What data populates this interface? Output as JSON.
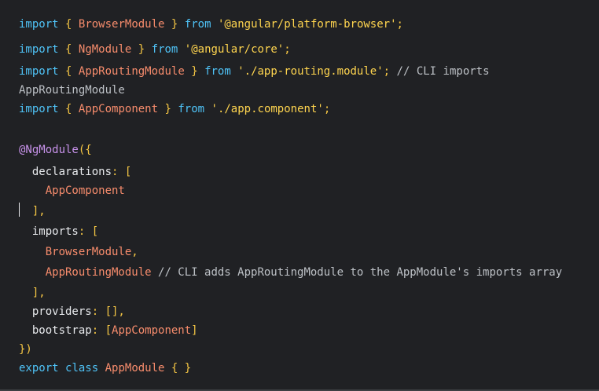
{
  "code": {
    "line1": {
      "k1": "import",
      "b1": "{",
      "c1": "BrowserModule",
      "b2": "}",
      "k2": "from",
      "s1": "'@angular/platform-browser'",
      "p1": ";"
    },
    "line2": {
      "k1": "import",
      "b1": "{",
      "c1": "NgModule",
      "b2": "}",
      "k2": "from",
      "s1": "'@angular/core'",
      "p1": ";"
    },
    "line3": {
      "k1": "import",
      "b1": "{",
      "c1": "AppRoutingModule",
      "b2": "}",
      "k2": "from",
      "s1": "'./app-routing.module'",
      "p1": ";",
      "cm": "// CLI imports"
    },
    "line3b": {
      "t": "AppRoutingModule"
    },
    "line4": {
      "k1": "import",
      "b1": "{",
      "c1": "AppComponent",
      "b2": "}",
      "k2": "from",
      "s1": "'./app.component'",
      "p1": ";"
    },
    "line6": {
      "d": "@NgModule",
      "p": "({"
    },
    "line7": {
      "prop": "declarations",
      "p": ": ["
    },
    "line8": {
      "c": "AppComponent"
    },
    "line9": {
      "p": "],"
    },
    "line10": {
      "prop": "imports",
      "p": ": ["
    },
    "line11": {
      "c": "BrowserModule",
      "p": ","
    },
    "line12": {
      "c": "AppRoutingModule",
      "cm": "// CLI adds AppRoutingModule to the AppModule's imports array"
    },
    "line13": {
      "p": "],"
    },
    "line14": {
      "prop": "providers",
      "p": ": [],"
    },
    "line15": {
      "prop": "bootstrap",
      "p1": ": [",
      "c": "AppComponent",
      "p2": "]"
    },
    "line16": {
      "p": "})"
    },
    "line17": {
      "k1": "export",
      "k2": "class",
      "c": "AppModule",
      "b": "{ }"
    }
  }
}
